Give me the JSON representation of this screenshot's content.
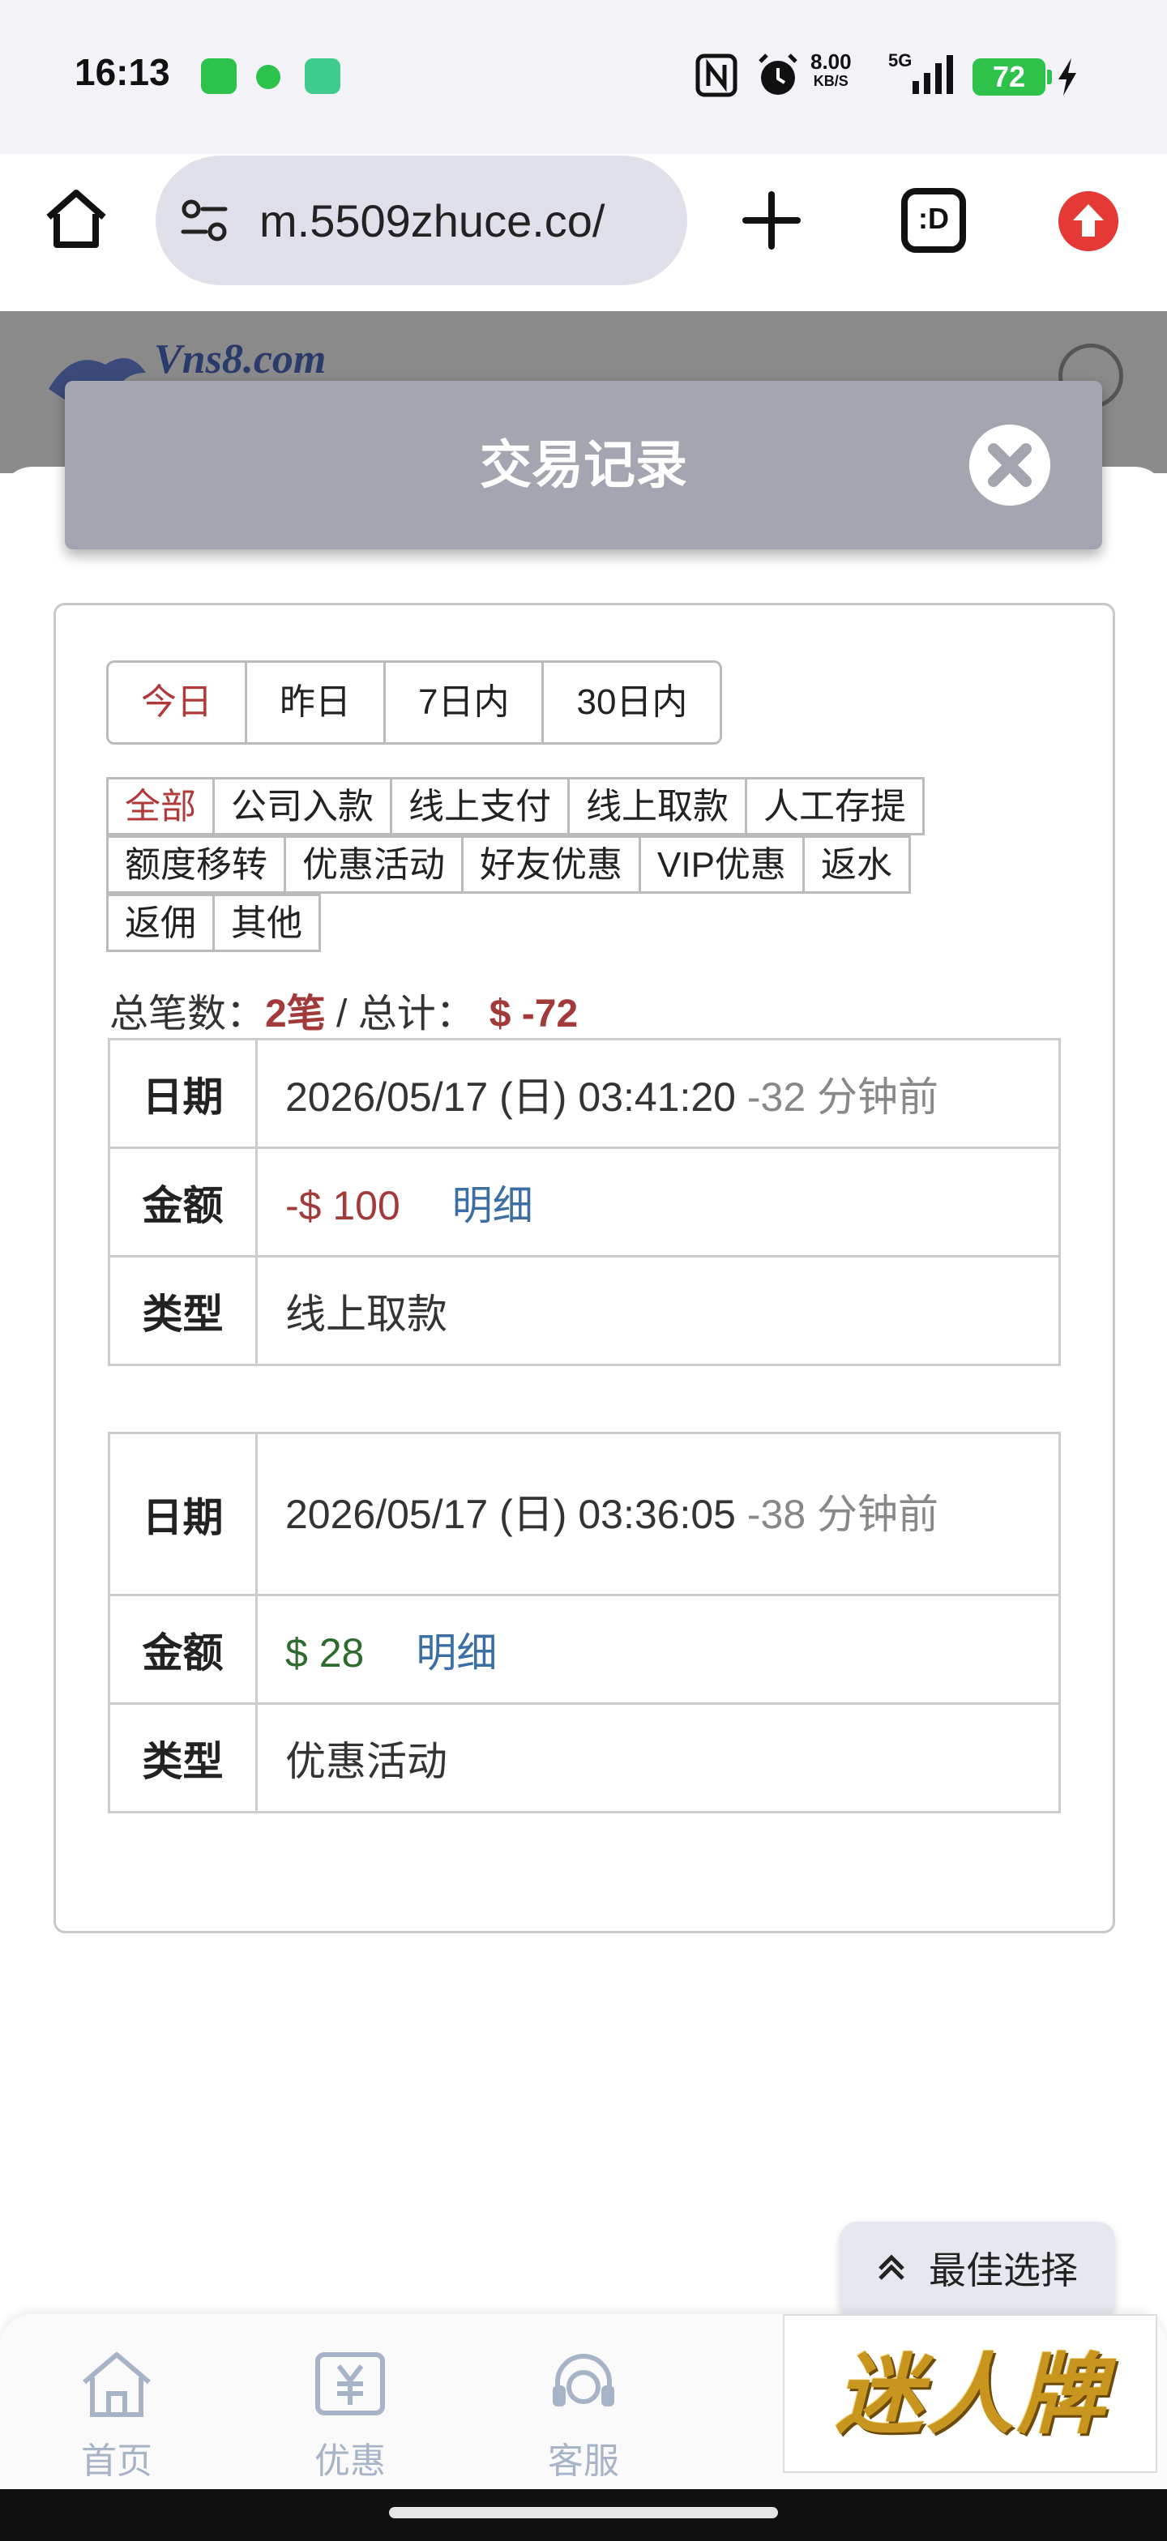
{
  "status_bar": {
    "time": "16:13",
    "net_speed": "8.00",
    "net_unit": "KB/S",
    "signal": "5G",
    "battery": "72"
  },
  "browser": {
    "url": "m.5509zhuce.co/",
    "tabs_label": ":D"
  },
  "site": {
    "logo_text": "Vns8.com"
  },
  "modal": {
    "title": "交易记录"
  },
  "date_tabs": [
    {
      "label": "今日"
    },
    {
      "label": "昨日"
    },
    {
      "label": "7日内"
    },
    {
      "label": "30日内"
    }
  ],
  "type_tabs": {
    "row1": [
      "全部",
      "公司入款",
      "线上支付",
      "线上取款",
      "人工存提"
    ],
    "row2": [
      "额度移转",
      "优惠活动",
      "好友优惠",
      "VIP优惠",
      "返水"
    ],
    "row3": [
      "返佣",
      "其他"
    ]
  },
  "summary": {
    "count_label": "总笔数：",
    "count_value": "2笔",
    "separator": " / ",
    "total_label": "总计：",
    "total_value": "$ -72"
  },
  "records": [
    {
      "date_label": "日期",
      "date": "2026/05/17 (日) 03:41:20",
      "ago": " -32 分钟前",
      "amount_label": "金额",
      "amount": "-$ 100",
      "detail": "明细",
      "type_label": "类型",
      "type": "线上取款"
    },
    {
      "date_label": "日期",
      "date": "2026/05/17 (日) 03:36:05",
      "ago": " -38 分钟前",
      "amount_label": "金额",
      "amount": "$ 28",
      "detail": "明细",
      "type_label": "类型",
      "type": "优惠活动"
    }
  ],
  "best_choice": {
    "label": "最佳选择"
  },
  "bottom_nav": [
    {
      "label": "首页",
      "icon": "home-icon"
    },
    {
      "label": "优惠",
      "icon": "coupon-icon"
    },
    {
      "label": "客服",
      "icon": "headset-icon"
    }
  ],
  "promo": {
    "text": "迷人牌"
  },
  "colors": {
    "active": "#b03a3a",
    "negative": "#a33a3a",
    "positive": "#2e6b2e",
    "link": "#3a6ea5",
    "modal_header": "#a3a6b0"
  }
}
